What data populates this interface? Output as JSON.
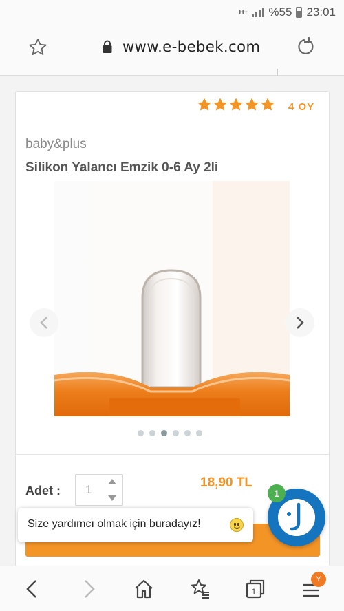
{
  "status_bar": {
    "network": "H+",
    "battery_text": "%55",
    "time": "23:01"
  },
  "browser": {
    "url": "www.e-bebek.com",
    "tab_count": "1",
    "menu_badge": "Y"
  },
  "product": {
    "rating_stars": 5,
    "votes_label": "4 OY",
    "brand": "baby&plus",
    "title": "Silikon Yalancı Emzik 0-6 Ay 2li",
    "image_count": 6,
    "active_image_index": 2,
    "quantity_label": "Adet :",
    "quantity_value": "1",
    "price": "18,90 TL"
  },
  "chat": {
    "message": "Size yardımcı olmak için buradayız!",
    "badge": "1"
  },
  "colors": {
    "accent": "#f39427",
    "chat_blue": "#1475be",
    "badge_green": "#4caf50"
  },
  "icons": [
    "star-outline-icon",
    "lock-icon",
    "reload-icon",
    "chevron-left-icon",
    "chevron-right-icon",
    "home-icon",
    "bookmarks-icon",
    "tabs-icon",
    "menu-icon"
  ]
}
